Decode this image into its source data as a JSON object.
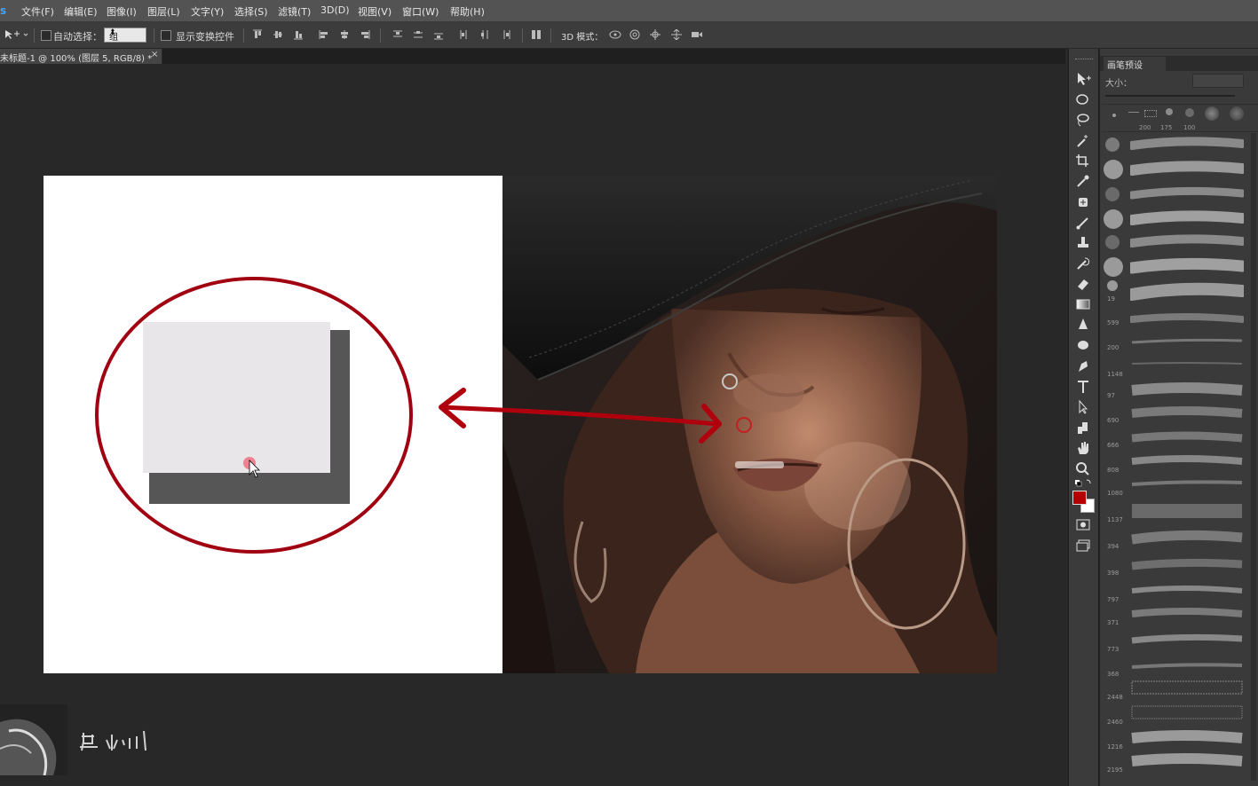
{
  "app": {
    "logo": "s"
  },
  "menu": [
    "文件(F)",
    "编辑(E)",
    "图像(I)",
    "图层(L)",
    "文字(Y)",
    "选择(S)",
    "滤镜(T)",
    "3D(D)",
    "视图(V)",
    "窗口(W)",
    "帮助(H)"
  ],
  "options": {
    "auto_select_label": "自动选择：",
    "auto_select_value": "组",
    "show_transform_label": "显示变换控件",
    "mode_3d_label": "3D 模式："
  },
  "document_tab": {
    "title": "未标题-1 @ 100% (图层 5, RGB/8) *",
    "close": "×"
  },
  "colors": {
    "accent_red": "#b00000",
    "foreground": "#b40000",
    "background": "#ffffff"
  },
  "brush_panel": {
    "tab": "画笔预设",
    "size_label": "大小：",
    "preset_sizes": [
      "200",
      "175",
      "100"
    ],
    "brush_sizes": [
      "19",
      "599",
      "200",
      "1148",
      "97",
      "690",
      "666",
      "808",
      "1080",
      "1137",
      "394",
      "398",
      "797",
      "371",
      "773",
      "368",
      "2448",
      "2460",
      "1216",
      "2195"
    ]
  },
  "tools": [
    "move-icon",
    "marquee-icon",
    "lasso-icon",
    "magic-wand-icon",
    "crop-icon",
    "eyedropper-icon",
    "healing-icon",
    "brush-icon",
    "stamp-icon",
    "history-brush-icon",
    "eraser-icon",
    "gradient-icon",
    "blur-icon",
    "dodge-icon",
    "pen-icon",
    "type-icon",
    "path-select-icon",
    "shape-icon",
    "hand-icon",
    "zoom-icon"
  ],
  "watermark": {
    "signature": "吕小川"
  }
}
